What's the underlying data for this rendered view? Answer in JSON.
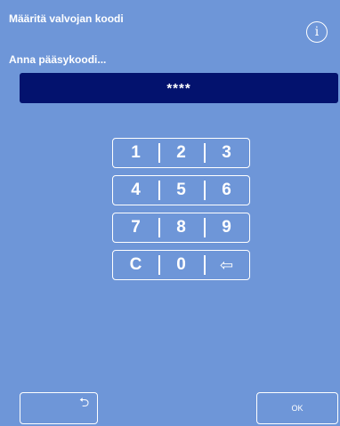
{
  "header": {
    "title": "Määritä valvojan koodi",
    "info_icon": "i"
  },
  "prompt": "Anna pääsykoodi...",
  "code_field": {
    "masked_value": "****"
  },
  "keypad": {
    "rows": [
      [
        "1",
        "2",
        "3"
      ],
      [
        "4",
        "5",
        "6"
      ],
      [
        "7",
        "8",
        "9"
      ],
      [
        "C",
        "0",
        "⇦"
      ]
    ]
  },
  "footer": {
    "back_icon": "⮌",
    "ok_label": "OK"
  },
  "colors": {
    "background": "#6e96d8",
    "code_field": "#03126e",
    "foreground": "#ffffff"
  }
}
